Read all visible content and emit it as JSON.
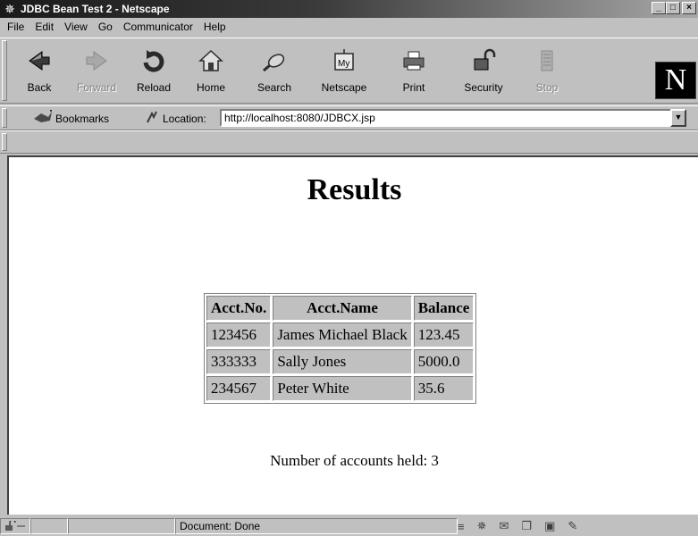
{
  "window": {
    "title": "JDBC Bean Test 2 - Netscape",
    "controls": {
      "minimize": "_",
      "maximize": "□",
      "close": "×"
    }
  },
  "menu": [
    "File",
    "Edit",
    "View",
    "Go",
    "Communicator",
    "Help"
  ],
  "nav_toolbar": [
    {
      "label": "Back",
      "icon": "back-arrow-icon",
      "enabled": true
    },
    {
      "label": "Forward",
      "icon": "forward-arrow-icon",
      "enabled": false
    },
    {
      "label": "Reload",
      "icon": "reload-icon",
      "enabled": true
    },
    {
      "label": "Home",
      "icon": "home-icon",
      "enabled": true
    },
    {
      "label": "Search",
      "icon": "search-icon",
      "enabled": true
    },
    {
      "label": "Netscape",
      "icon": "netscape-my-icon",
      "enabled": true
    },
    {
      "label": "Print",
      "icon": "printer-icon",
      "enabled": true
    },
    {
      "label": "Security",
      "icon": "padlock-icon",
      "enabled": true
    },
    {
      "label": "Stop",
      "icon": "stop-icon",
      "enabled": false
    }
  ],
  "brand": {
    "logo_letter": "N"
  },
  "location_bar": {
    "bookmarks_label": "Bookmarks",
    "location_label": "Location:",
    "url": "http://localhost:8080/JDBCX.jsp"
  },
  "page": {
    "heading": "Results",
    "table": {
      "headers": [
        "Acct.No.",
        "Acct.Name",
        "Balance"
      ],
      "rows": [
        [
          "123456",
          "James Michael Black",
          "123.45"
        ],
        [
          "333333",
          "Sally Jones",
          "5000.0"
        ],
        [
          "234567",
          "Peter White",
          "35.6"
        ]
      ]
    },
    "summary": "Number of accounts held: 3"
  },
  "status": {
    "text": "Document: Done"
  }
}
